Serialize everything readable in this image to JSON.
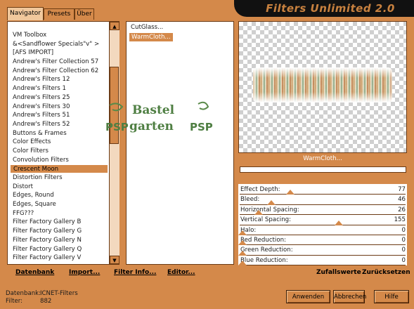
{
  "app": {
    "title": "Filters Unlimited 2.0"
  },
  "tabs": [
    {
      "label": "Navigator"
    },
    {
      "label": "Presets"
    },
    {
      "label": "Über"
    }
  ],
  "categories": [
    "VM Toolbox",
    "&<Sandflower Specials\"v\" >",
    "[AFS IMPORT]",
    "Andrew's Filter Collection 57",
    "Andrew's Filter Collection 62",
    "Andrew's Filters 12",
    "Andrew's Filters 1",
    "Andrew's Filters 25",
    "Andrew's Filters 30",
    "Andrew's Filters 51",
    "Andrew's Filters 52",
    "Buttons & Frames",
    "Color Effects",
    "Color Filters",
    "Convolution Filters",
    "Crescent Moon",
    "Distortion Filters",
    "Distort",
    "Edges, Round",
    "Edges, Square",
    "FFG???",
    "Filter Factory Gallery B",
    "Filter Factory Gallery G",
    "Filter Factory Gallery N",
    "Filter Factory Gallery Q",
    "Filter Factory Gallery V"
  ],
  "selected_category": "Crescent Moon",
  "filters": [
    "CutGlass...",
    "WarmCloth..."
  ],
  "selected_filter": "WarmCloth...",
  "watermark": {
    "line1": "Bastel",
    "line2": "garten",
    "mark": "PSP"
  },
  "preview": {
    "label": "WarmCloth..."
  },
  "parameters": [
    {
      "label": "Effect Depth:",
      "value": 77
    },
    {
      "label": "Bleed:",
      "value": 46
    },
    {
      "label": "Horizontal Spacing:",
      "value": 26
    },
    {
      "label": "Vertical Spacing:",
      "value": 155
    },
    {
      "label": "Halo:",
      "value": 0
    },
    {
      "label": "Red Reduction:",
      "value": 0
    },
    {
      "label": "Green Reduction:",
      "value": 0
    },
    {
      "label": "Blue Reduction:",
      "value": 0
    }
  ],
  "toolbar": {
    "database": "Datenbank",
    "import": "Import...",
    "filter_info": "Filter Info...",
    "editor": "Editor...",
    "random": "Zufallswerte",
    "reset": "Zurücksetzen"
  },
  "status": {
    "db_label": "Datenbank:",
    "db_value": "ICNET-Filters",
    "filter_label": "Filter:",
    "filter_value": "882"
  },
  "buttons": {
    "apply": "Anwenden",
    "cancel": "Abbrechen",
    "help": "Hilfe"
  },
  "colors": {
    "accent": "#d4894a",
    "title_bg": "#111111",
    "panel": "#ffffff"
  }
}
